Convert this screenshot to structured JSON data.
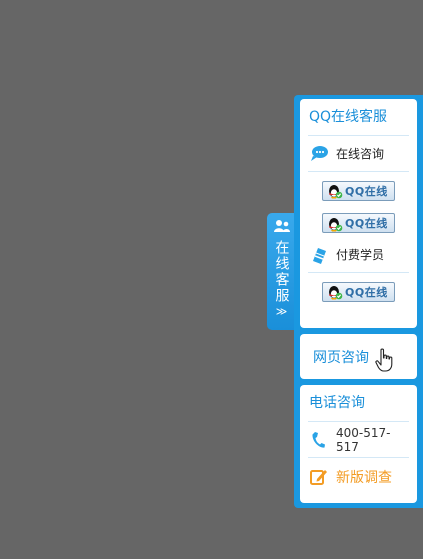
{
  "side_tab": {
    "label": "在线客服",
    "arrow": "≫"
  },
  "qq_section": {
    "title": "QQ在线客服",
    "consult_label": "在线咨询",
    "paid_label": "付费学员",
    "qq_button_label": "QQ在线"
  },
  "web_section": {
    "label": "网页咨询"
  },
  "phone_section": {
    "title": "电话咨询",
    "number": "400-517-517",
    "survey_label": "新版调查"
  },
  "colors": {
    "accent": "#1a98e0",
    "survey": "#f39c24",
    "background": "#666666"
  }
}
